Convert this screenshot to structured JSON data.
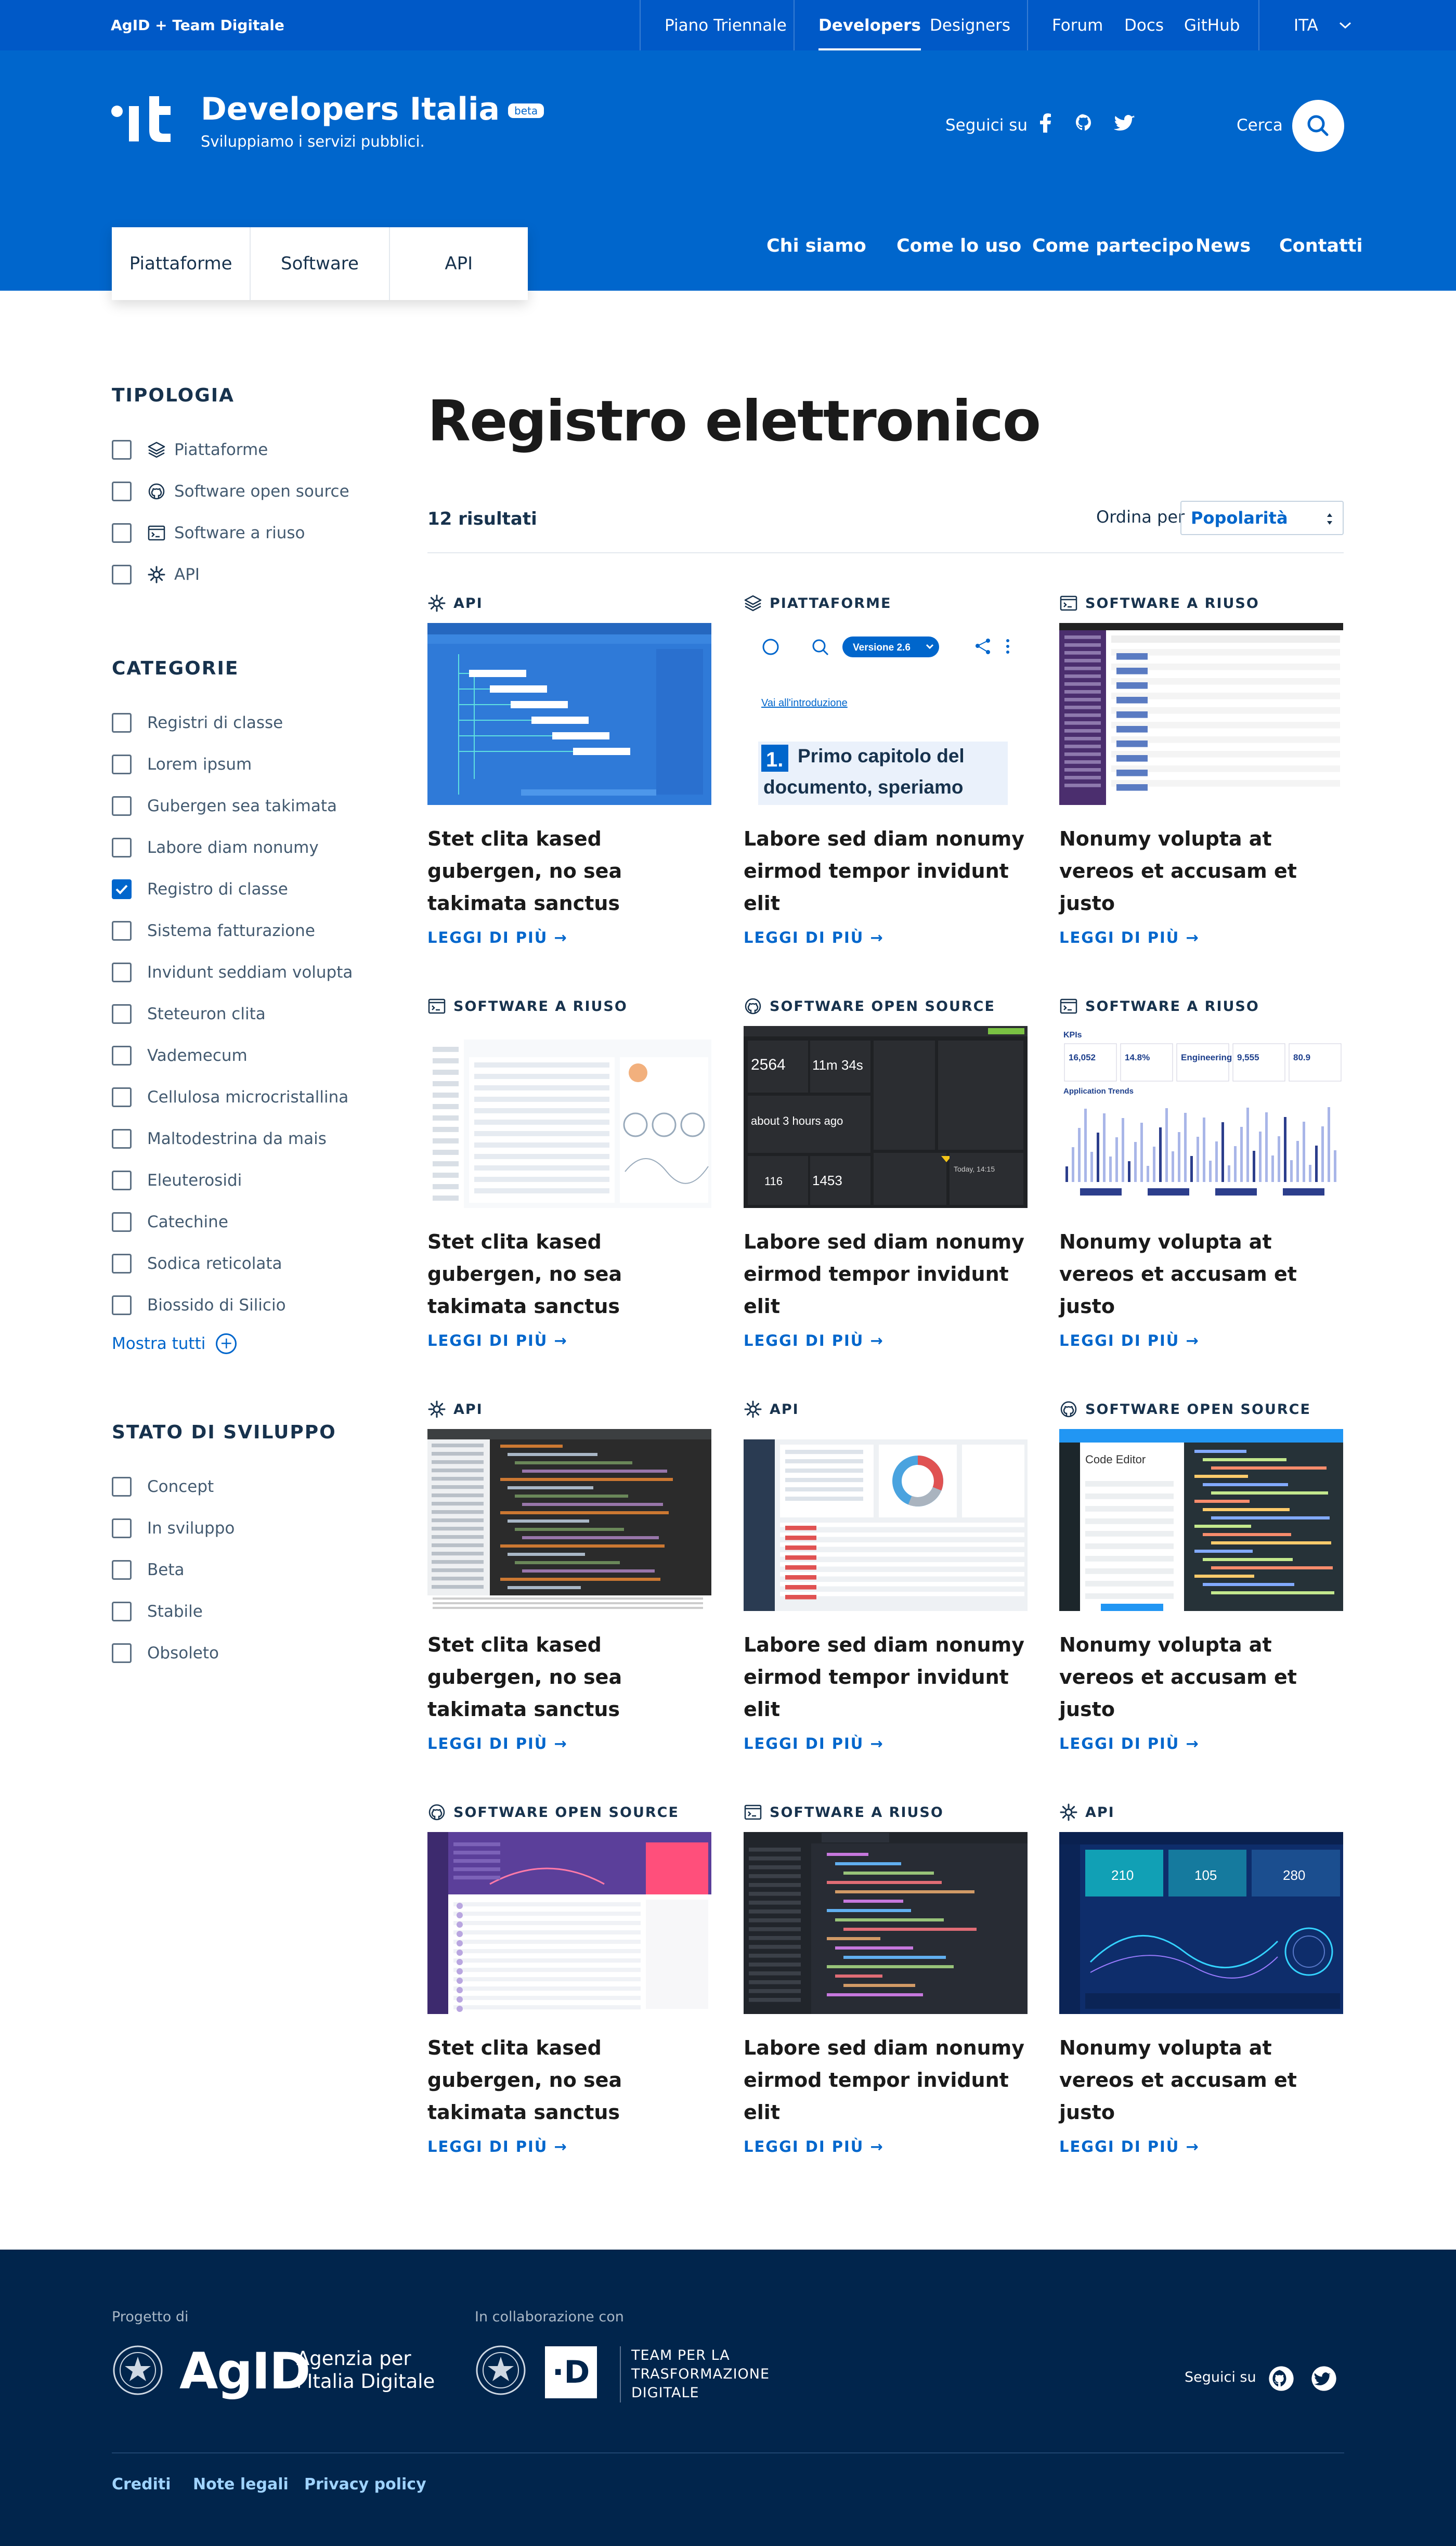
{
  "topbar": {
    "brand": "AgID + Team Digitale",
    "links": [
      "Piano Triennale",
      "Developers",
      "Designers",
      "Forum",
      "Docs",
      "GitHub"
    ],
    "active": "Developers",
    "language": "ITA"
  },
  "header": {
    "logo_text": "·it",
    "title": "Developers Italia",
    "badge": "beta",
    "tagline": "Sviluppiamo i servizi pubblici.",
    "follow_label": "Seguici su",
    "search_label": "Cerca",
    "tabs": [
      "Piattaforme",
      "Software",
      "API"
    ],
    "nav": [
      "Chi siamo",
      "Come lo uso",
      "Come partecipo",
      "News",
      "Contatti"
    ]
  },
  "sidebar": {
    "tipologia": {
      "heading": "TIPOLOGIA",
      "items": [
        {
          "label": "Piattaforme",
          "icon": "layers-icon",
          "checked": false
        },
        {
          "label": "Software open source",
          "icon": "github-icon",
          "checked": false
        },
        {
          "label": "Software a riuso",
          "icon": "terminal-window-icon",
          "checked": false
        },
        {
          "label": "API",
          "icon": "gear-icon",
          "checked": false
        }
      ]
    },
    "categorie": {
      "heading": "CATEGORIE",
      "items": [
        {
          "label": "Registri di classe",
          "checked": false
        },
        {
          "label": "Lorem ipsum",
          "checked": false
        },
        {
          "label": "Gubergen sea takimata",
          "checked": false
        },
        {
          "label": "Labore diam nonumy",
          "checked": false
        },
        {
          "label": "Registro di classe",
          "checked": true
        },
        {
          "label": "Sistema fatturazione",
          "checked": false
        },
        {
          "label": "Invidunt seddiam volupta",
          "checked": false
        },
        {
          "label": "Steteuron clita",
          "checked": false
        },
        {
          "label": "Vademecum",
          "checked": false
        },
        {
          "label": "Cellulosa microcristallina",
          "checked": false
        },
        {
          "label": "Maltodestrina da mais",
          "checked": false
        },
        {
          "label": "Eleuterosidi",
          "checked": false
        },
        {
          "label": "Catechine",
          "checked": false
        },
        {
          "label": "Sodica reticolata",
          "checked": false
        },
        {
          "label": "Biossido di Silicio",
          "checked": false
        }
      ],
      "show_all": "Mostra tutti"
    },
    "stato": {
      "heading": "STATO DI SVILUPPO",
      "items": [
        {
          "label": "Concept",
          "checked": false
        },
        {
          "label": "In sviluppo",
          "checked": false
        },
        {
          "label": "Beta",
          "checked": false
        },
        {
          "label": "Stabile",
          "checked": false
        },
        {
          "label": "Obsoleto",
          "checked": false
        }
      ]
    }
  },
  "main": {
    "title": "Registro elettronico",
    "results": "12 risultati",
    "order_label": "Ordina per",
    "order_value": "Popolarità",
    "read_more": "LEGGI DI PIÙ →",
    "thumb_texts": {
      "version": "Versione 2.6",
      "intro_link": "Vai all'introduzione",
      "chapter_num": "1.",
      "chapter": "Primo capitolo del documento, speriamo",
      "code_editor": "Code Editor",
      "kpis": "KPIs",
      "app_trends": "Application Trends",
      "kpi_values": [
        "16,052",
        "14.8%",
        "Engineering",
        "9,555",
        "80.9"
      ],
      "dark_values": [
        "2564",
        "11m 34s",
        "about 3 hours ago",
        "116",
        "1453",
        "Today, 14:15"
      ],
      "gauge_values": [
        "210",
        "105",
        "280"
      ]
    },
    "cards": [
      {
        "type": "API",
        "icon": "gear-icon",
        "title": "Stet clita kased gubergen, no sea takimata sanctus",
        "thumb": "gantt"
      },
      {
        "type": "PIATTAFORME",
        "icon": "layers-icon",
        "title": "Labore sed diam nonumy eirmod tempor invidunt elit",
        "thumb": "docs"
      },
      {
        "type": "SOFTWARE A RIUSO",
        "icon": "terminal-window-icon",
        "title": "Nonumy volupta at vereos et accusam et justo",
        "thumb": "admin"
      },
      {
        "type": "SOFTWARE A RIUSO",
        "icon": "terminal-window-icon",
        "title": "Stet clita kased gubergen, no sea takimata sanctus",
        "thumb": "profile"
      },
      {
        "type": "SOFTWARE OPEN SOURCE",
        "icon": "github-icon",
        "title": "Labore sed diam nonumy eirmod tempor invidunt elit",
        "thumb": "darkdash"
      },
      {
        "type": "SOFTWARE A RIUSO",
        "icon": "terminal-window-icon",
        "title": "Nonumy volupta at vereos et accusam et justo",
        "thumb": "kpi"
      },
      {
        "type": "API",
        "icon": "gear-icon",
        "title": "Stet clita kased gubergen, no sea takimata sanctus",
        "thumb": "ide"
      },
      {
        "type": "API",
        "icon": "gear-icon",
        "title": "Labore sed diam nonumy eirmod tempor invidunt elit",
        "thumb": "donut"
      },
      {
        "type": "SOFTWARE OPEN SOURCE",
        "icon": "github-icon",
        "title": "Nonumy volupta at vereos et accusam et justo",
        "thumb": "codeeditor"
      },
      {
        "type": "SOFTWARE OPEN SOURCE",
        "icon": "github-icon",
        "title": "Stet clita kased gubergen, no sea takimata sanctus",
        "thumb": "purple"
      },
      {
        "type": "SOFTWARE A RIUSO",
        "icon": "terminal-window-icon",
        "title": "Labore sed diam nonumy eirmod tempor invidunt elit",
        "thumb": "atom"
      },
      {
        "type": "API",
        "icon": "gear-icon",
        "title": "Nonumy volupta at vereos et accusam et justo",
        "thumb": "bluedash"
      }
    ]
  },
  "footer": {
    "project_label": "Progetto di",
    "agid": "AgID",
    "agid_sub_1": "Agenzia per",
    "agid_sub_2": "l'Italia Digitale",
    "collab_label": "In collaborazione con",
    "d_logo": "·D",
    "team": "TEAM PER LA TRASFORMAZIONE DIGITALE",
    "follow": "Seguici su",
    "links": [
      "Crediti",
      "Note legali",
      "Privacy policy"
    ]
  },
  "colors": {
    "primary": "#0066cc",
    "topbar": "#0059c7",
    "footer": "#01254c",
    "text": "#17324d",
    "link": "#0066cc"
  }
}
